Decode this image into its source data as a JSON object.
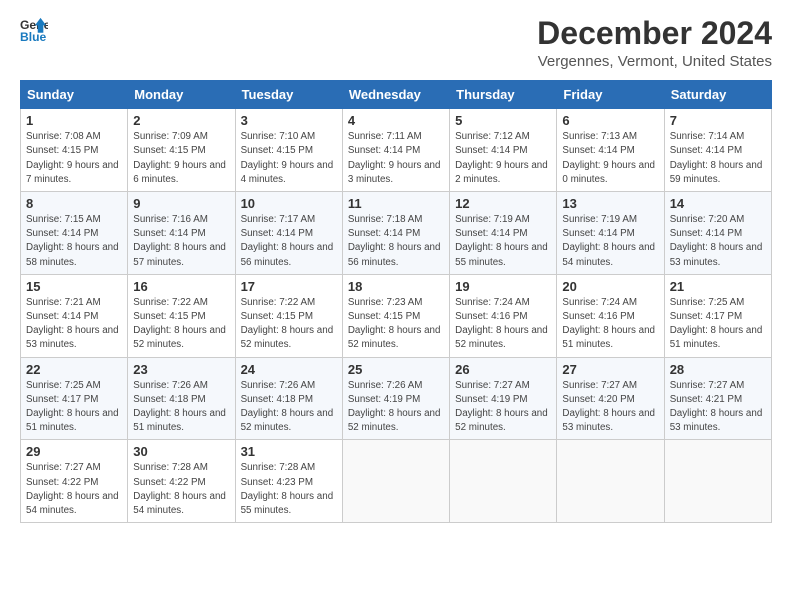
{
  "header": {
    "logo_line1": "General",
    "logo_line2": "Blue",
    "title": "December 2024",
    "subtitle": "Vergennes, Vermont, United States"
  },
  "weekdays": [
    "Sunday",
    "Monday",
    "Tuesday",
    "Wednesday",
    "Thursday",
    "Friday",
    "Saturday"
  ],
  "weeks": [
    [
      {
        "day": "1",
        "sunrise": "7:08 AM",
        "sunset": "4:15 PM",
        "daylight": "9 hours and 7 minutes."
      },
      {
        "day": "2",
        "sunrise": "7:09 AM",
        "sunset": "4:15 PM",
        "daylight": "9 hours and 6 minutes."
      },
      {
        "day": "3",
        "sunrise": "7:10 AM",
        "sunset": "4:15 PM",
        "daylight": "9 hours and 4 minutes."
      },
      {
        "day": "4",
        "sunrise": "7:11 AM",
        "sunset": "4:14 PM",
        "daylight": "9 hours and 3 minutes."
      },
      {
        "day": "5",
        "sunrise": "7:12 AM",
        "sunset": "4:14 PM",
        "daylight": "9 hours and 2 minutes."
      },
      {
        "day": "6",
        "sunrise": "7:13 AM",
        "sunset": "4:14 PM",
        "daylight": "9 hours and 0 minutes."
      },
      {
        "day": "7",
        "sunrise": "7:14 AM",
        "sunset": "4:14 PM",
        "daylight": "8 hours and 59 minutes."
      }
    ],
    [
      {
        "day": "8",
        "sunrise": "7:15 AM",
        "sunset": "4:14 PM",
        "daylight": "8 hours and 58 minutes."
      },
      {
        "day": "9",
        "sunrise": "7:16 AM",
        "sunset": "4:14 PM",
        "daylight": "8 hours and 57 minutes."
      },
      {
        "day": "10",
        "sunrise": "7:17 AM",
        "sunset": "4:14 PM",
        "daylight": "8 hours and 56 minutes."
      },
      {
        "day": "11",
        "sunrise": "7:18 AM",
        "sunset": "4:14 PM",
        "daylight": "8 hours and 56 minutes."
      },
      {
        "day": "12",
        "sunrise": "7:19 AM",
        "sunset": "4:14 PM",
        "daylight": "8 hours and 55 minutes."
      },
      {
        "day": "13",
        "sunrise": "7:19 AM",
        "sunset": "4:14 PM",
        "daylight": "8 hours and 54 minutes."
      },
      {
        "day": "14",
        "sunrise": "7:20 AM",
        "sunset": "4:14 PM",
        "daylight": "8 hours and 53 minutes."
      }
    ],
    [
      {
        "day": "15",
        "sunrise": "7:21 AM",
        "sunset": "4:14 PM",
        "daylight": "8 hours and 53 minutes."
      },
      {
        "day": "16",
        "sunrise": "7:22 AM",
        "sunset": "4:15 PM",
        "daylight": "8 hours and 52 minutes."
      },
      {
        "day": "17",
        "sunrise": "7:22 AM",
        "sunset": "4:15 PM",
        "daylight": "8 hours and 52 minutes."
      },
      {
        "day": "18",
        "sunrise": "7:23 AM",
        "sunset": "4:15 PM",
        "daylight": "8 hours and 52 minutes."
      },
      {
        "day": "19",
        "sunrise": "7:24 AM",
        "sunset": "4:16 PM",
        "daylight": "8 hours and 52 minutes."
      },
      {
        "day": "20",
        "sunrise": "7:24 AM",
        "sunset": "4:16 PM",
        "daylight": "8 hours and 51 minutes."
      },
      {
        "day": "21",
        "sunrise": "7:25 AM",
        "sunset": "4:17 PM",
        "daylight": "8 hours and 51 minutes."
      }
    ],
    [
      {
        "day": "22",
        "sunrise": "7:25 AM",
        "sunset": "4:17 PM",
        "daylight": "8 hours and 51 minutes."
      },
      {
        "day": "23",
        "sunrise": "7:26 AM",
        "sunset": "4:18 PM",
        "daylight": "8 hours and 51 minutes."
      },
      {
        "day": "24",
        "sunrise": "7:26 AM",
        "sunset": "4:18 PM",
        "daylight": "8 hours and 52 minutes."
      },
      {
        "day": "25",
        "sunrise": "7:26 AM",
        "sunset": "4:19 PM",
        "daylight": "8 hours and 52 minutes."
      },
      {
        "day": "26",
        "sunrise": "7:27 AM",
        "sunset": "4:19 PM",
        "daylight": "8 hours and 52 minutes."
      },
      {
        "day": "27",
        "sunrise": "7:27 AM",
        "sunset": "4:20 PM",
        "daylight": "8 hours and 53 minutes."
      },
      {
        "day": "28",
        "sunrise": "7:27 AM",
        "sunset": "4:21 PM",
        "daylight": "8 hours and 53 minutes."
      }
    ],
    [
      {
        "day": "29",
        "sunrise": "7:27 AM",
        "sunset": "4:22 PM",
        "daylight": "8 hours and 54 minutes."
      },
      {
        "day": "30",
        "sunrise": "7:28 AM",
        "sunset": "4:22 PM",
        "daylight": "8 hours and 54 minutes."
      },
      {
        "day": "31",
        "sunrise": "7:28 AM",
        "sunset": "4:23 PM",
        "daylight": "8 hours and 55 minutes."
      },
      null,
      null,
      null,
      null
    ]
  ]
}
